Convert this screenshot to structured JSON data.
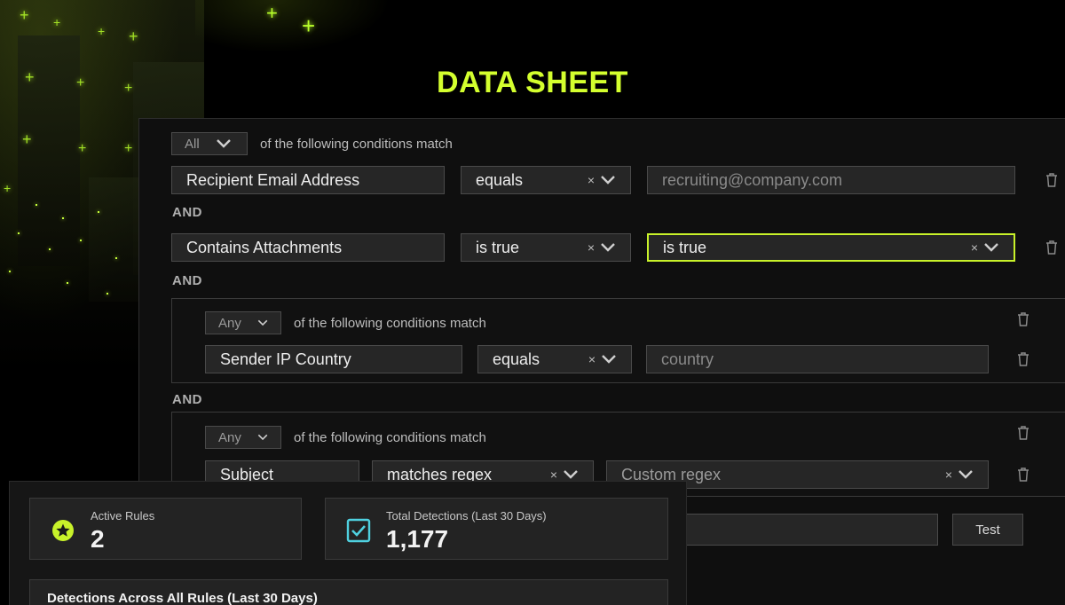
{
  "title": "DATA SHEET",
  "root": {
    "match_mode": "All",
    "match_text": "of the following conditions match"
  },
  "rows": [
    {
      "field": "Recipient Email Address",
      "operator": "equals",
      "value": "recruiting@company.com"
    },
    {
      "field": "Contains Attachments",
      "operator": "is true",
      "value": "is true"
    }
  ],
  "and_label": "AND",
  "groups": [
    {
      "match_mode": "Any",
      "match_text": "of the following conditions match",
      "row": {
        "field": "Sender IP Country",
        "operator": "equals",
        "value": "country"
      }
    },
    {
      "match_mode": "Any",
      "match_text": "of the following conditions match",
      "row": {
        "field": "Subject",
        "operator": "matches regex",
        "value": "Custom regex"
      }
    }
  ],
  "test_button": "Test",
  "stats": {
    "active_rules_label": "Active Rules",
    "active_rules_value": "2",
    "total_detections_label": "Total Detections (Last 30 Days)",
    "total_detections_value": "1,177",
    "detections_chart_title": "Detections Across All Rules (Last 30 Days)"
  },
  "icons": {
    "clear": "×",
    "chevron": "chevron-down-icon",
    "trash": "trash-icon",
    "star": "star-badge-icon",
    "check": "checkbox-icon"
  },
  "colors": {
    "accent": "#d4ff2e",
    "check_accent": "#4fd1e0"
  }
}
